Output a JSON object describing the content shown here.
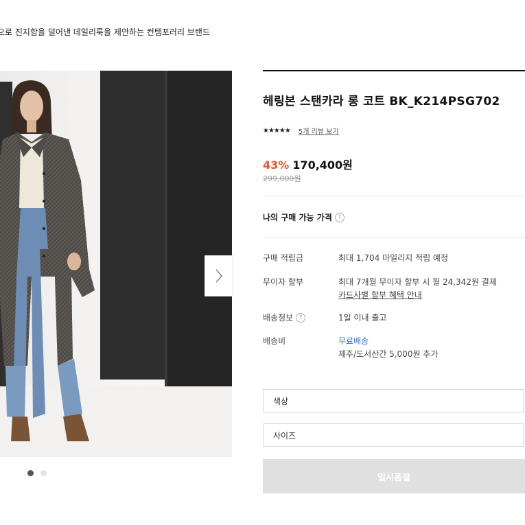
{
  "brand_tagline": "으로 진지함을 덜어낸 데일리룩을 제안하는 컨템포러리 브랜드",
  "gallery": {
    "image_alt": "헤링본 스탠카라 롱 코트 model photo",
    "dots_count": 2,
    "active_dot": 0
  },
  "product": {
    "title": "헤링본 스탠카라 롱 코트 BK_K214PSG702",
    "stars": "★★★★★",
    "review_link": "5개 리뷰 보기",
    "discount": "43%",
    "price": "170,400원",
    "original_price": "299,000원",
    "my_price_label": "나의 구매 가능 가격"
  },
  "details": {
    "points_label": "구매 적립금",
    "points_value": "최대 1,704 마일리지 적립 예정",
    "installment_label": "무이자 할부",
    "installment_value": "최대 7개월 무이자 할부 시 월 24,342원 결제",
    "installment_link": "카드사별 할부 혜택 안내",
    "shipping_info_label": "배송정보",
    "shipping_info_value": "1일 이내 출고",
    "shipping_fee_label": "배송비",
    "shipping_fee_value": "무료배송",
    "shipping_fee_note": "제주/도서산간 5,000원 추가"
  },
  "options": {
    "color_placeholder": "색상",
    "size_placeholder": "사이즈"
  },
  "buy_button_label": "일시품절",
  "colors": {
    "discount": "#e4572e",
    "link_blue": "#3a6fbf",
    "disabled_button": "#e0e0e0"
  }
}
